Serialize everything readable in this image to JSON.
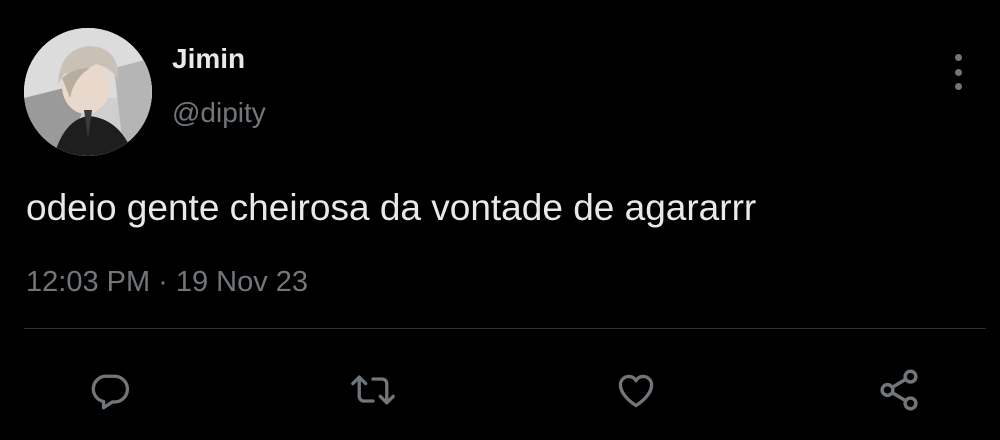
{
  "tweet": {
    "author": {
      "name": "Jimin",
      "handle": "@dipity",
      "avatar_icon": "profile-photo-avatar"
    },
    "text": "odeio gente cheirosa da vontade de agararrr",
    "time": "12:03 PM",
    "separator": "·",
    "date": "19 Nov 23",
    "menu_icon": "more-vertical-icon"
  },
  "actions": {
    "reply_icon": "reply-bubble-icon",
    "retweet_icon": "retweet-icon",
    "like_icon": "heart-icon",
    "share_icon": "share-icon"
  },
  "colors": {
    "background": "#000000",
    "primary_text": "#e7e9ea",
    "secondary_text": "#71767b",
    "divider": "#2f3336"
  }
}
